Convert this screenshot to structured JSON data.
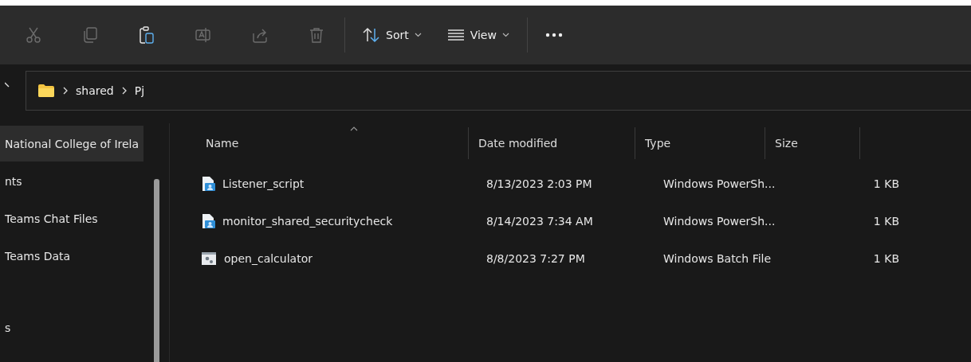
{
  "toolbar": {
    "actions": [
      {
        "kind": "cut",
        "disabled": true
      },
      {
        "kind": "copy",
        "disabled": true
      },
      {
        "kind": "paste",
        "disabled": false
      },
      {
        "kind": "rename",
        "disabled": true
      },
      {
        "kind": "share",
        "disabled": true
      },
      {
        "kind": "delete",
        "disabled": true
      }
    ],
    "menus": [
      {
        "kind": "sort",
        "label": "Sort"
      },
      {
        "kind": "view",
        "label": "View"
      }
    ]
  },
  "address": {
    "crumbs": [
      "shared",
      "Pj"
    ]
  },
  "sidebar": {
    "items": [
      {
        "label": "National College of Irela",
        "selected": true
      },
      {
        "label": "nts",
        "selected": false
      },
      {
        "label": "Teams Chat Files",
        "selected": false
      },
      {
        "label": "Teams Data",
        "selected": false
      },
      {
        "label": "s",
        "selected": false
      }
    ]
  },
  "table": {
    "columns": [
      "Name",
      "Date modified",
      "Type",
      "Size"
    ],
    "rows": [
      {
        "kind": "powershell",
        "name": "Listener_script",
        "date": "8/13/2023 2:03 PM",
        "type": "Windows PowerSh...",
        "size": "1 KB"
      },
      {
        "kind": "powershell",
        "name": "monitor_shared_securitycheck",
        "date": "8/14/2023 7:34 AM",
        "type": "Windows PowerSh...",
        "size": "1 KB"
      },
      {
        "kind": "batch",
        "name": "open_calculator",
        "date": "8/8/2023 7:27 PM",
        "type": "Windows Batch File",
        "size": "1 KB"
      }
    ]
  }
}
